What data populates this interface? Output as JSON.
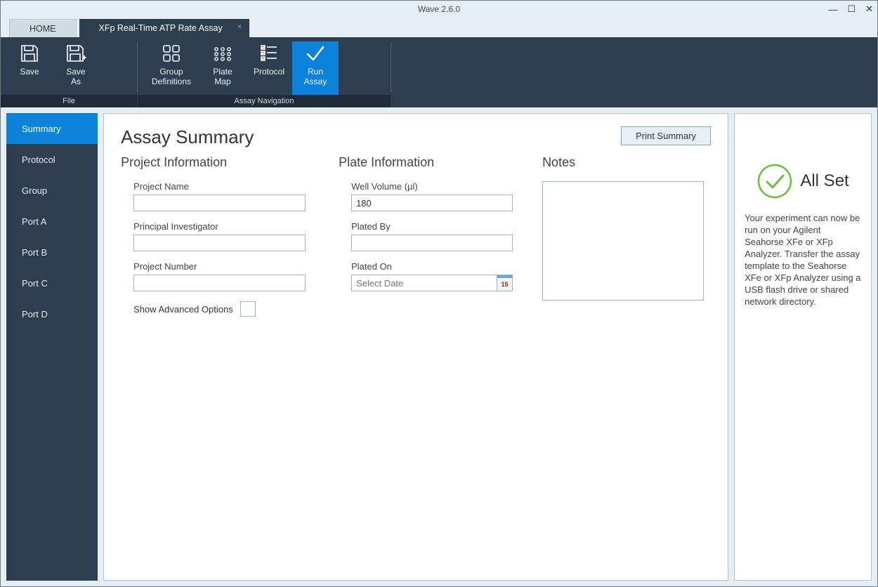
{
  "window": {
    "title": "Wave 2.6.0"
  },
  "tabs": {
    "home": "HOME",
    "active": "XFp Real-Time ATP Rate Assay"
  },
  "ribbon": {
    "file": {
      "label": "File",
      "save": "Save",
      "save_as": "Save\nAs"
    },
    "nav": {
      "label": "Assay Navigation",
      "group_defs": "Group\nDefinitions",
      "plate_map": "Plate\nMap",
      "protocol": "Protocol",
      "run_assay": "Run\nAssay"
    }
  },
  "sidebar": {
    "items": [
      {
        "label": "Summary"
      },
      {
        "label": "Protocol"
      },
      {
        "label": "Group"
      },
      {
        "label": "Port A"
      },
      {
        "label": "Port B"
      },
      {
        "label": "Port C"
      },
      {
        "label": "Port D"
      }
    ]
  },
  "main": {
    "title": "Assay Summary",
    "print": "Print Summary",
    "project": {
      "heading": "Project Information",
      "name_label": "Project Name",
      "name_value": "",
      "pi_label": "Principal Investigator",
      "pi_value": "",
      "number_label": "Project Number",
      "number_value": "",
      "adv_label": "Show Advanced Options"
    },
    "plate": {
      "heading": "Plate Information",
      "well_label": "Well Volume (µl)",
      "well_value": "180",
      "plated_by_label": "Plated By",
      "plated_by_value": "",
      "plated_on_label": "Plated On",
      "plated_on_placeholder": "Select Date",
      "cal_day": "15"
    },
    "notes": {
      "heading": "Notes",
      "value": ""
    }
  },
  "right": {
    "title": "All Set",
    "body": "Your experiment can now be run on your Agilent Seahorse XFe or XFp Analyzer. Transfer the assay template to the Seahorse XFe or XFp Analyzer using a USB flash drive or shared network directory."
  }
}
